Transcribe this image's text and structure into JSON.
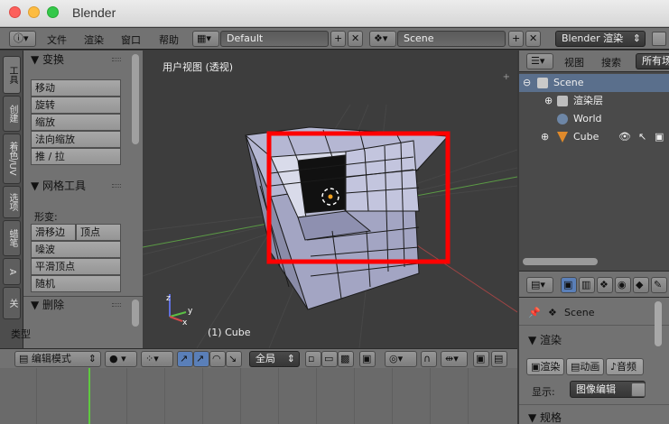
{
  "window": {
    "title": "Blender"
  },
  "info_header": {
    "menus": [
      "文件",
      "渲染",
      "窗口",
      "帮助"
    ],
    "layout": "Default",
    "scene": "Scene",
    "engine": "Blender 渲染"
  },
  "tool_tabs": [
    "工具",
    "创建",
    "着色/UV",
    "选项",
    "蜡笔",
    "A",
    "关"
  ],
  "toolshelf": {
    "transform_header": "▼ 变换",
    "transform_buttons": [
      "移动",
      "旋转",
      "缩放",
      "法向缩放",
      "推 / 拉"
    ],
    "mesh_tools_header": "▼ 网格工具",
    "deform_label": "形变:",
    "slide_edge": "滑移边",
    "vertex": "顶点",
    "mesh_buttons": [
      "噪波",
      "平滑顶点",
      "随机"
    ],
    "delete_header": "▼ 删除",
    "type_label": "类型"
  },
  "viewport": {
    "view_label": "用户视图 (透视)",
    "object_label": "(1) Cube",
    "axis_labels": [
      "z",
      "y",
      "x"
    ]
  },
  "viewport_header": {
    "mode": "编辑模式",
    "pivot": "全局"
  },
  "outliner": {
    "header": {
      "view": "视图",
      "search": "搜索",
      "filter": "所有场"
    },
    "items": [
      {
        "label": "Scene"
      },
      {
        "label": "渲染层"
      },
      {
        "label": "World"
      },
      {
        "label": "Cube"
      }
    ]
  },
  "properties": {
    "scene_label": "Scene",
    "render_header": "▼ 渲染",
    "render_btn": "渲染",
    "anim_btn": "动画",
    "audio_btn": "音频",
    "display_label": "显示:",
    "display_value": "图像编辑",
    "dims_header": "▼ 规格"
  },
  "colors": {
    "highlight": "#ff0000",
    "timeline_cursor": "#5ec93f",
    "cube_face": "#a9abc9"
  }
}
